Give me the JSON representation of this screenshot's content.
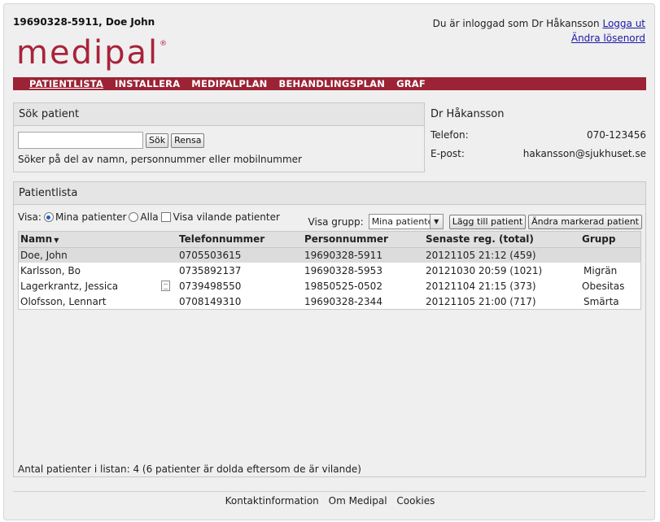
{
  "header": {
    "user_id": "19690328-5911, Doe John",
    "logo_text": "medipal",
    "logo_reg": "®",
    "logged_in_text": "Du är inloggad som Dr Håkansson",
    "logout_label": "Logga ut",
    "change_password_label": "Ändra lösenord"
  },
  "nav": {
    "items": [
      {
        "label": "PATIENTLISTA"
      },
      {
        "label": "INSTALLERA"
      },
      {
        "label": "MEDIPALPLAN"
      },
      {
        "label": "BEHANDLINGSPLAN"
      },
      {
        "label": "GRAF"
      }
    ]
  },
  "search": {
    "title": "Sök patient",
    "input_value": "",
    "search_button": "Sök",
    "clear_button": "Rensa",
    "hint": "Söker på del av namn, personnummer eller mobilnummer"
  },
  "doctor": {
    "name": "Dr Håkansson",
    "phone_label": "Telefon:",
    "phone": "070-123456",
    "email_label": "E-post:",
    "email": "hakansson@sjukhuset.se"
  },
  "patient_list": {
    "title": "Patientlista",
    "visa_label": "Visa:",
    "radio_mine": "Mina patienter",
    "radio_all": "Alla",
    "checkbox_resting": "Visa vilande patienter",
    "group_label": "Visa grupp:",
    "group_selected": "Mina patienter",
    "add_button": "Lägg till patient",
    "edit_button": "Ändra markerad patient",
    "columns": {
      "name": "Namn",
      "sort_arrow": "▼",
      "phone": "Telefonnummer",
      "pnr": "Personnummer",
      "latest": "Senaste reg. (total)",
      "group": "Grupp"
    },
    "rows": [
      {
        "name": "Doe, John",
        "phone": "0705503615",
        "pnr": "19690328-5911",
        "latest": "20121105 21:12 (459)",
        "group": ""
      },
      {
        "name": "Karlsson, Bo",
        "phone": "0735892137",
        "pnr": "19690328-5953",
        "latest": "20121030 20:59 (1021)",
        "group": "Migrän"
      },
      {
        "name": "Lagerkrantz, Jessica",
        "phone": "0739498550",
        "pnr": "19850525-0502",
        "latest": "20121104 21:15 (373)",
        "group": "Obesitas"
      },
      {
        "name": "Olofsson, Lennart",
        "phone": "0708149310",
        "pnr": "19690328-2344",
        "latest": "20121105 21:00 (717)",
        "group": "Smärta"
      }
    ],
    "count_text": "Antal patienter i listan: 4 (6 patienter är dolda eftersom de är vilande)"
  },
  "footer": {
    "contact": "Kontaktinformation",
    "about": "Om Medipal",
    "cookies": "Cookies"
  },
  "colors": {
    "brand": "#9b2335",
    "link": "#1a1aa6"
  }
}
